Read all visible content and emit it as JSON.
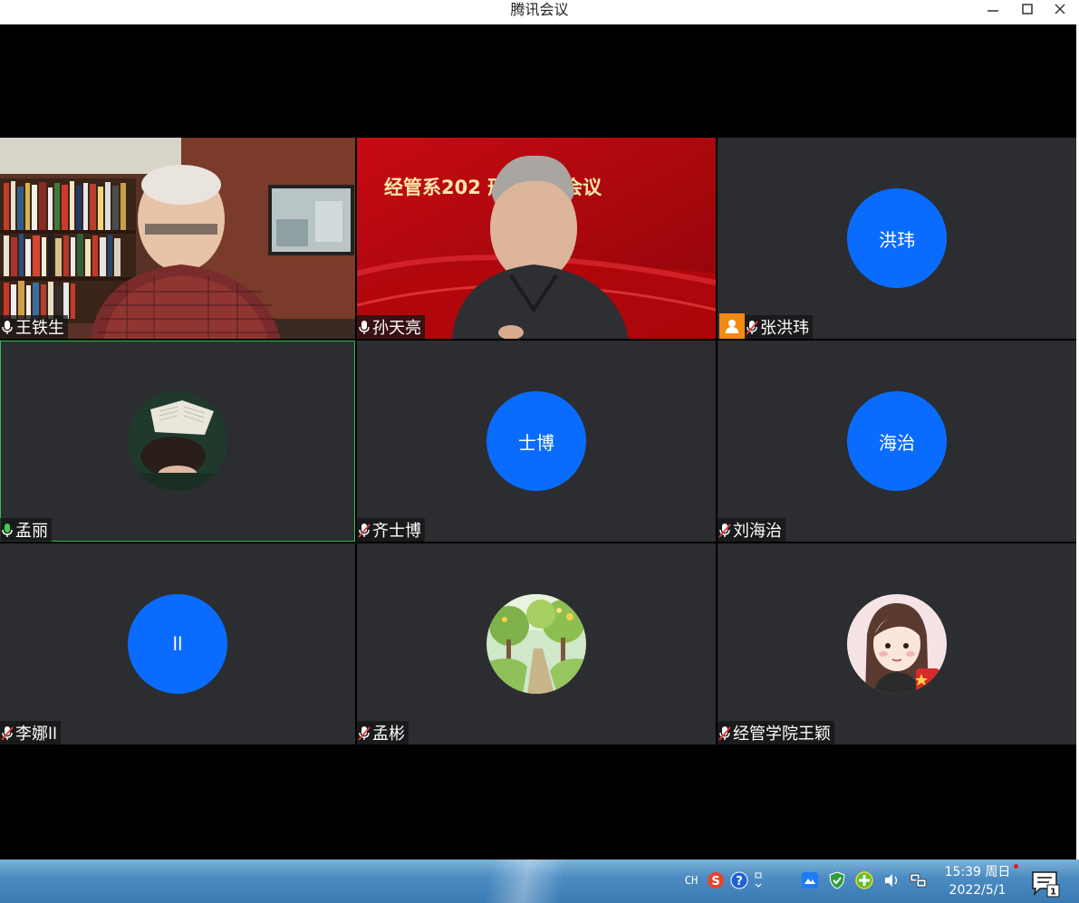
{
  "window": {
    "title": "腾讯会议"
  },
  "participants": [
    {
      "name": "王铁生",
      "mic": "on",
      "tile_type": "video",
      "scene": "bookshelf-room"
    },
    {
      "name": "孙天亮",
      "mic": "on",
      "tile_type": "video",
      "scene": "red-banner",
      "banner_text": "经管系202    形态工作会议"
    },
    {
      "name": "张洪玮",
      "mic": "muted",
      "tile_type": "avatar-initials",
      "initials": "洪玮",
      "host": true
    },
    {
      "name": "孟丽",
      "mic": "speaking",
      "tile_type": "avatar-photo",
      "active_speaker": true
    },
    {
      "name": "齐士博",
      "mic": "muted",
      "tile_type": "avatar-initials",
      "initials": "士博"
    },
    {
      "name": "刘海治",
      "mic": "muted",
      "tile_type": "avatar-initials",
      "initials": "海治"
    },
    {
      "name": "李娜ll",
      "mic": "muted",
      "tile_type": "avatar-initials",
      "initials": "ll"
    },
    {
      "name": "孟彬",
      "mic": "muted",
      "tile_type": "avatar-photo"
    },
    {
      "name": "经管学院王颖",
      "mic": "muted",
      "tile_type": "avatar-photo"
    }
  ],
  "taskbar": {
    "lang": "CH",
    "time": "15:39 周日",
    "date": "2022/5/1",
    "notification_count": "1",
    "tray_icons": [
      "sogou-ime-icon",
      "help-icon",
      "ime-options-icon",
      "tencent-meeting-tray-icon",
      "security-shield-icon",
      "green-plus-icon",
      "volume-icon",
      "network-icon"
    ]
  },
  "colors": {
    "avatar_blue": "#0a6cff",
    "host_orange": "#f58a12",
    "tile_bg": "#2b2d30",
    "active_border": "#2fbf4c"
  }
}
